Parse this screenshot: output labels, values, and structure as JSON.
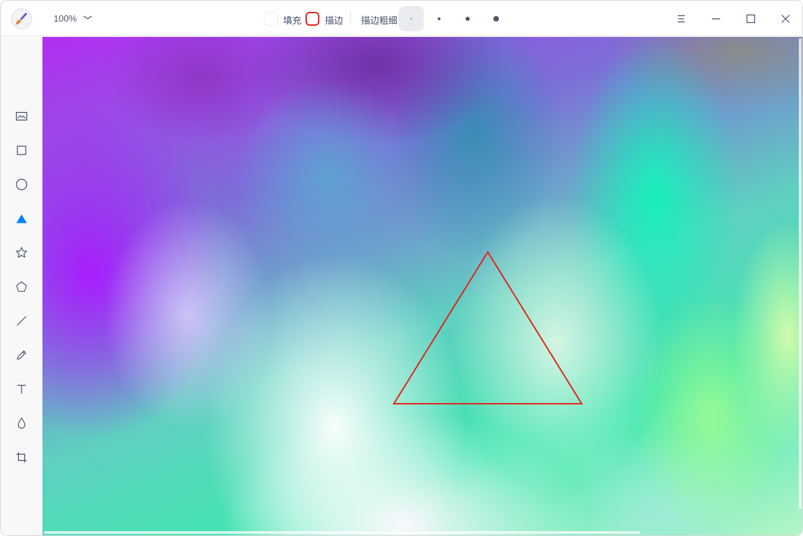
{
  "app": {
    "icon": "paint-brush-icon"
  },
  "header": {
    "zoom_value": "100%",
    "fill_label": "填充",
    "fill_color": "#ffffff",
    "stroke_label": "描边",
    "stroke_color": "#e2231a",
    "stroke_width_label": "描边粗细",
    "stroke_width_options": [
      "1",
      "2",
      "3",
      "4"
    ],
    "stroke_width_selected_index": 0
  },
  "window_controls": {
    "menu_icon": "menu-icon",
    "minimize_icon": "minimize-icon",
    "maximize_icon": "maximize-icon",
    "close_icon": "close-icon"
  },
  "toolbar": {
    "tools": [
      {
        "id": "image",
        "icon": "image-icon"
      },
      {
        "id": "rectangle",
        "icon": "rectangle-icon"
      },
      {
        "id": "ellipse",
        "icon": "ellipse-icon"
      },
      {
        "id": "triangle",
        "icon": "triangle-icon",
        "active": true
      },
      {
        "id": "star",
        "icon": "star-icon"
      },
      {
        "id": "polygon",
        "icon": "polygon-icon"
      },
      {
        "id": "line",
        "icon": "line-icon"
      },
      {
        "id": "pencil",
        "icon": "pencil-icon"
      },
      {
        "id": "text",
        "icon": "text-icon"
      },
      {
        "id": "blur",
        "icon": "blur-drop-icon"
      },
      {
        "id": "crop",
        "icon": "crop-icon"
      }
    ],
    "active_color": "#0081ff"
  },
  "canvas": {
    "shape": {
      "type": "triangle",
      "stroke": "#e2231a",
      "fill": "none"
    }
  }
}
